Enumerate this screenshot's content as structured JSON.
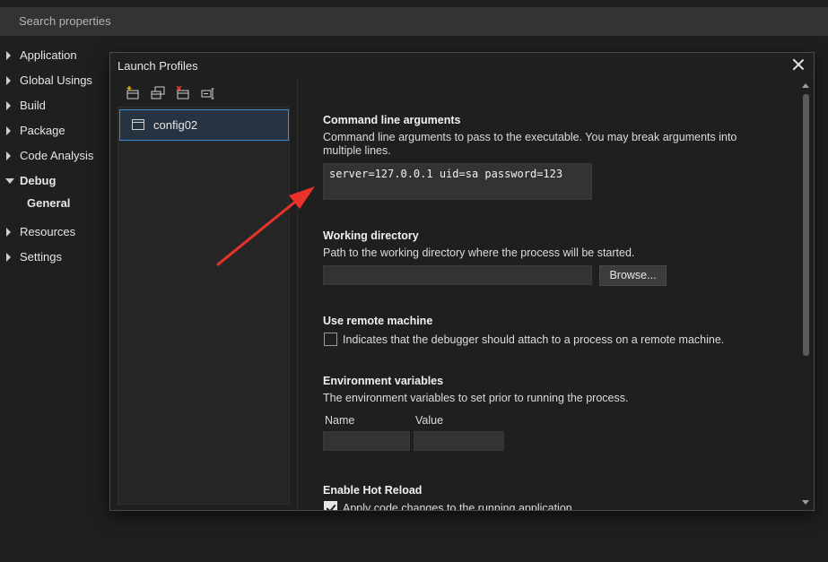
{
  "search": {
    "placeholder": "Search properties"
  },
  "nav": {
    "items": [
      {
        "label": "Application"
      },
      {
        "label": "Global Usings"
      },
      {
        "label": "Build"
      },
      {
        "label": "Package"
      },
      {
        "label": "Code Analysis"
      },
      {
        "label": "Debug",
        "expanded": true
      },
      {
        "label": "Resources"
      },
      {
        "label": "Settings"
      }
    ],
    "sub_item": "General"
  },
  "dialog": {
    "title": "Launch Profiles",
    "toolbar_icons": [
      "new-profile-icon",
      "duplicate-profile-icon",
      "delete-profile-icon",
      "rename-profile-icon"
    ],
    "profiles": [
      {
        "label": "config02",
        "selected": true
      }
    ],
    "command_line": {
      "title": "Command line arguments",
      "desc": "Command line arguments to pass to the executable. You may break arguments into multiple lines.",
      "value": "server=127.0.0.1 uid=sa password=123"
    },
    "working_dir": {
      "title": "Working directory",
      "desc": "Path to the working directory where the process will be started.",
      "value": "",
      "browse_label": "Browse..."
    },
    "remote": {
      "title": "Use remote machine",
      "checkbox_label": "Indicates that the debugger should attach to a process on a remote machine.",
      "checked": false
    },
    "env": {
      "title": "Environment variables",
      "desc": "The environment variables to set prior to running the process.",
      "col_name": "Name",
      "col_value": "Value"
    },
    "hot_reload": {
      "title": "Enable Hot Reload",
      "checkbox_label": "Apply code changes to the running application.",
      "checked": true
    }
  },
  "colors": {
    "accent": "#3b8fd6",
    "annotation_arrow": "#e8322a"
  }
}
